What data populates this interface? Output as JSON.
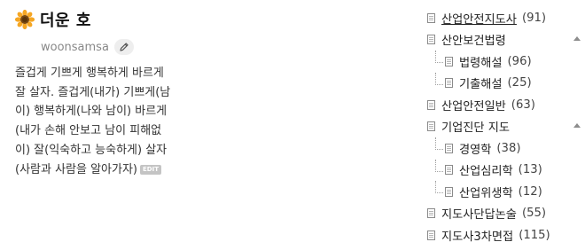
{
  "profile": {
    "nickname": "더운 호",
    "blog_id": "woonsamsa",
    "intro": "즐겁게 기쁘게 행복하게 바르게 잘 살자. 즐겁게(내가) 기쁘게(남이) 행복하게(나와 남이) 바르게(내가 손해 안보고 남이 피해없이) 잘(익숙하고 능숙하게) 살자(사람과 사람을 알아가자)",
    "edit_badge": "EDIT",
    "avatar_icon": "sunflower-icon",
    "edit_icon": "pencil-icon"
  },
  "category": {
    "items": [
      {
        "label": "산업안전지도사",
        "count": "(91)",
        "selected": true
      },
      {
        "label": "산안보건법령",
        "count": "",
        "collapsible": true
      },
      {
        "label": "법령해설",
        "count": "(96)",
        "sub": true
      },
      {
        "label": "기출해설",
        "count": "(25)",
        "sub": true
      },
      {
        "label": "산업안전일반",
        "count": "(63)"
      },
      {
        "label": "기업진단 지도",
        "count": "",
        "collapsible": true
      },
      {
        "label": "경영학",
        "count": "(38)",
        "sub": true
      },
      {
        "label": "산업심리학",
        "count": "(13)",
        "sub": true
      },
      {
        "label": "산업위생학",
        "count": "(12)",
        "sub": true
      },
      {
        "label": "지도사단답논술",
        "count": "(55)"
      },
      {
        "label": "지도사3차면접",
        "count": "(115)"
      }
    ]
  }
}
